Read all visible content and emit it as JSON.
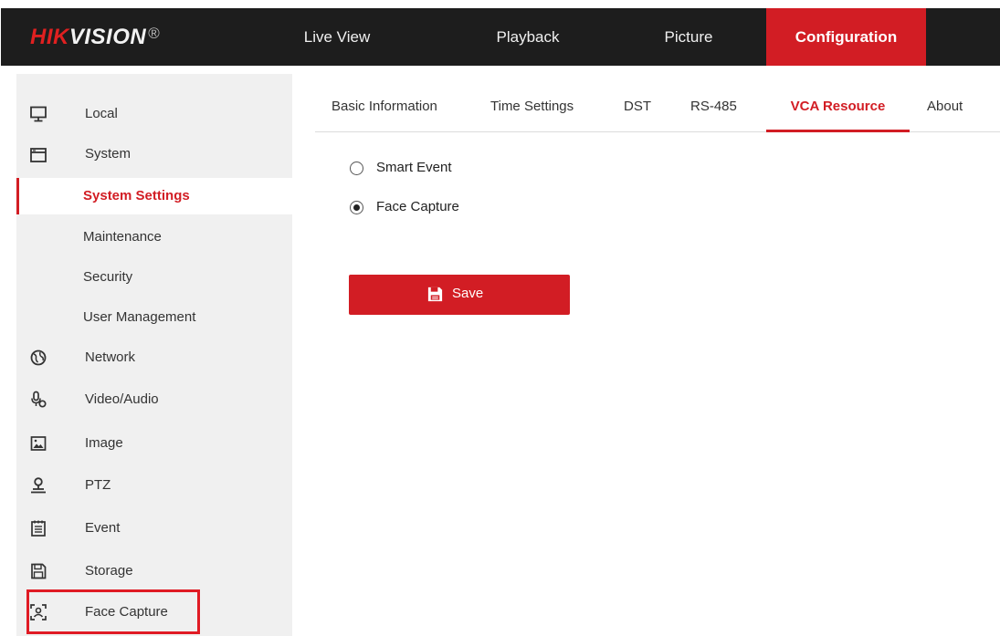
{
  "brand": {
    "hik": "HIK",
    "vision": "VISION",
    "reg": "®"
  },
  "nav": {
    "items": [
      {
        "label": "Live View"
      },
      {
        "label": "Playback"
      },
      {
        "label": "Picture"
      },
      {
        "label": "Configuration"
      }
    ],
    "active": "Configuration"
  },
  "sidebar": {
    "items": [
      {
        "label": "Local",
        "icon": "monitor-icon"
      },
      {
        "label": "System",
        "icon": "system-window-icon"
      },
      {
        "label": "System Settings",
        "sub": true,
        "active": true
      },
      {
        "label": "Maintenance",
        "sub": true
      },
      {
        "label": "Security",
        "sub": true
      },
      {
        "label": "User Management",
        "sub": true
      },
      {
        "label": "Network",
        "icon": "globe-icon"
      },
      {
        "label": "Video/Audio",
        "icon": "microphone-icon"
      },
      {
        "label": "Image",
        "icon": "image-icon"
      },
      {
        "label": "PTZ",
        "icon": "ptz-camera-icon"
      },
      {
        "label": "Event",
        "icon": "calendar-list-icon"
      },
      {
        "label": "Storage",
        "icon": "floppy-disk-icon"
      },
      {
        "label": "Face Capture",
        "icon": "face-capture-icon",
        "highlighted": true
      }
    ]
  },
  "tabs": {
    "items": [
      {
        "label": "Basic Information"
      },
      {
        "label": "Time Settings"
      },
      {
        "label": "DST"
      },
      {
        "label": "RS-485"
      },
      {
        "label": "VCA Resource"
      },
      {
        "label": "About"
      }
    ],
    "active": "VCA Resource"
  },
  "vca": {
    "options": [
      {
        "label": "Smart Event",
        "checked": false
      },
      {
        "label": "Face Capture",
        "checked": true
      }
    ]
  },
  "actions": {
    "save_label": "Save"
  },
  "colors": {
    "accent": "#d21d24",
    "topbar": "#1d1d1d",
    "sidebar": "#f0f0f0",
    "highlight": "#e01b24"
  }
}
